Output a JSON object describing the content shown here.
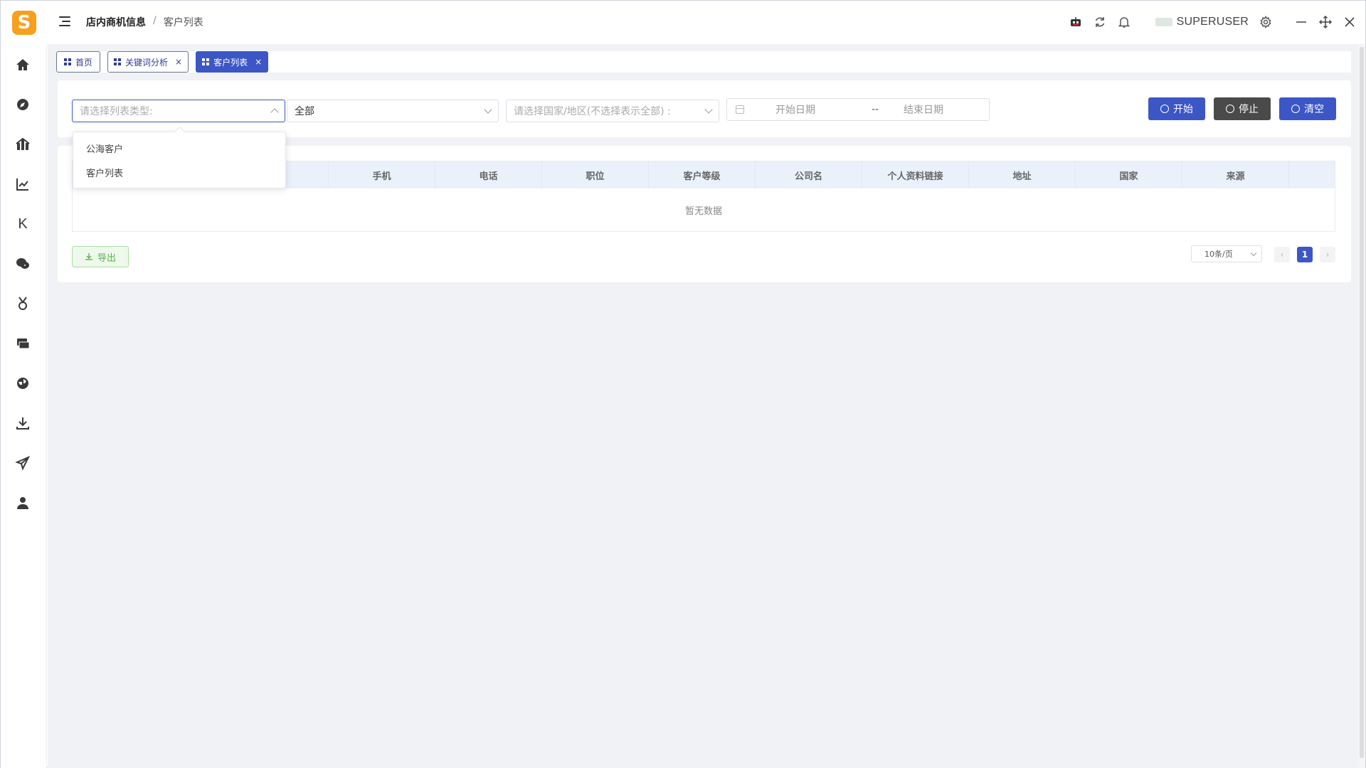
{
  "header": {
    "logo_letter": "S",
    "breadcrumb": [
      "店内商机信息",
      "客户列表"
    ],
    "breadcrumb_separator": "/",
    "username": "SUPERUSER",
    "icons": [
      "robot-icon",
      "refresh-icon",
      "bell-icon",
      "gear-icon",
      "minimize-icon",
      "move-icon",
      "close-icon"
    ]
  },
  "sidebar": {
    "items": [
      "home-icon",
      "compass-icon",
      "building-icon",
      "line-chart-icon",
      "k-letter-icon",
      "chat-icon",
      "medal-icon",
      "inbox-icon",
      "globe-icon",
      "download-icon",
      "send-icon",
      "user-icon"
    ],
    "k_label": "K"
  },
  "tabs": [
    {
      "label": "首页",
      "closable": false,
      "active": false
    },
    {
      "label": "关键词分析",
      "closable": true,
      "active": false
    },
    {
      "label": "客户列表",
      "closable": true,
      "active": true
    }
  ],
  "filters": {
    "list_type_placeholder": "请选择列表类型:",
    "scope_value": "全部",
    "country_placeholder": "请选择国家/地区(不选择表示全部) :",
    "date_start_placeholder": "开始日期",
    "date_separator": "--",
    "date_end_placeholder": "结束日期"
  },
  "buttons": {
    "start": "开始",
    "stop": "停止",
    "clear": "清空",
    "export": "导出"
  },
  "dropdown": {
    "options": [
      "公海客户",
      "客户列表"
    ]
  },
  "table": {
    "columns": [
      "手机",
      "电话",
      "职位",
      "客户等级",
      "公司名",
      "个人资料链接",
      "地址",
      "国家",
      "来源"
    ],
    "empty_text": "暂无数据"
  },
  "pagination": {
    "page_size": "10条/页",
    "current_page": "1",
    "prev": "‹",
    "next": "›"
  },
  "colors": {
    "primary": "#3c56c6",
    "dark_button": "#4a4a4a",
    "logo": "#f7a01d",
    "export_green": "#59b34c"
  }
}
